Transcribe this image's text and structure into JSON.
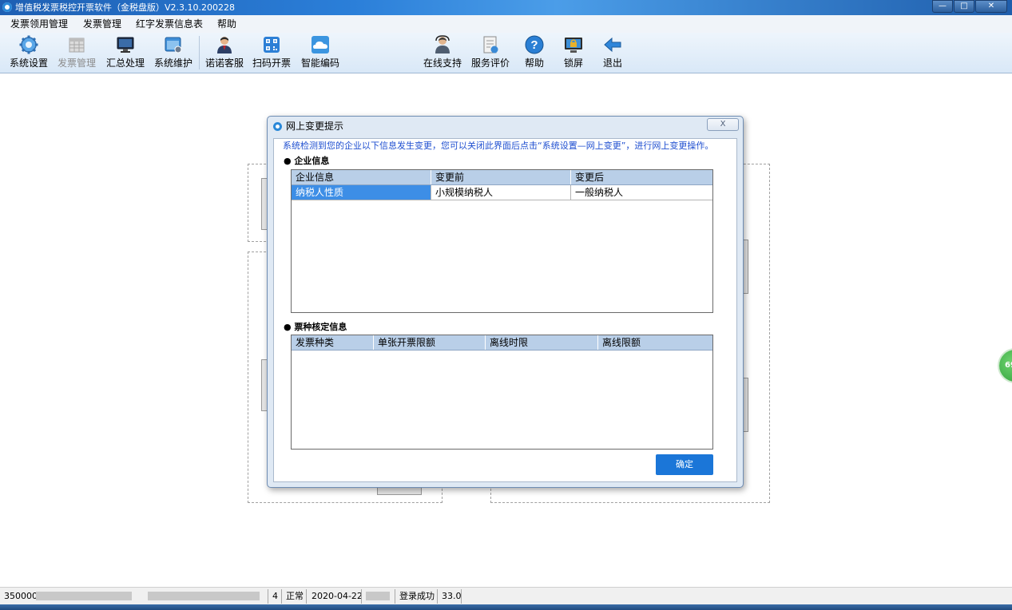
{
  "window": {
    "title": "增值税发票税控开票软件（金税盘版）V2.3.10.200228",
    "controls": {
      "minimize": "—",
      "maximize": "□",
      "close": "✕"
    }
  },
  "menu": [
    "发票领用管理",
    "发票管理",
    "红字发票信息表",
    "帮助"
  ],
  "toolbar": [
    {
      "label": "系统设置",
      "icon": "gear-icon",
      "enabled": true
    },
    {
      "label": "发票管理",
      "icon": "invoice-grid-icon",
      "enabled": false
    },
    {
      "label": "汇总处理",
      "icon": "monitor-icon",
      "enabled": true
    },
    {
      "label": "系统维护",
      "icon": "maintenance-window-icon",
      "enabled": true
    },
    {
      "label": "诺诺客服",
      "icon": "customer-service-person-icon",
      "enabled": true
    },
    {
      "label": "扫码开票",
      "icon": "qr-code-icon",
      "enabled": true
    },
    {
      "label": "智能编码",
      "icon": "cloud-icon",
      "enabled": true
    },
    {
      "label": "在线支持",
      "icon": "support-person-icon",
      "enabled": true
    },
    {
      "label": "服务评价",
      "icon": "evaluation-doc-icon",
      "enabled": true
    },
    {
      "label": "帮助",
      "icon": "help-icon",
      "enabled": true
    },
    {
      "label": "锁屏",
      "icon": "lock-screen-icon",
      "enabled": true
    },
    {
      "label": "退出",
      "icon": "exit-arrow-icon",
      "enabled": true
    }
  ],
  "dialog": {
    "title": "网上变更提示",
    "close_label": "X",
    "hint": "系统检测到您的企业以下信息发生变更，您可以关闭此界面后点击“系统设置—网上变更”，进行网上变更操作。",
    "company_section": {
      "title": "● 企业信息",
      "columns": [
        "企业信息",
        "变更前",
        "变更后"
      ],
      "rows": [
        [
          "纳税人性质",
          "小规模纳税人",
          "一般纳税人"
        ]
      ]
    },
    "ticket_section": {
      "title": "● 票种核定信息",
      "columns": [
        "发票种类",
        "单张开票限额",
        "离线时限",
        "离线限额"
      ],
      "rows": []
    },
    "ok_label": "确定"
  },
  "statusbar": {
    "id_prefix": "350000",
    "count": "4",
    "state": "正常",
    "date": "2020-04-22",
    "login": "登录成功",
    "version": "33.0"
  },
  "side_badge": "69",
  "colors": {
    "accent": "#1b76d8",
    "selection": "#3d8ee6",
    "grid_header": "#b9cfe8",
    "hint_text": "#1f4fd0"
  }
}
